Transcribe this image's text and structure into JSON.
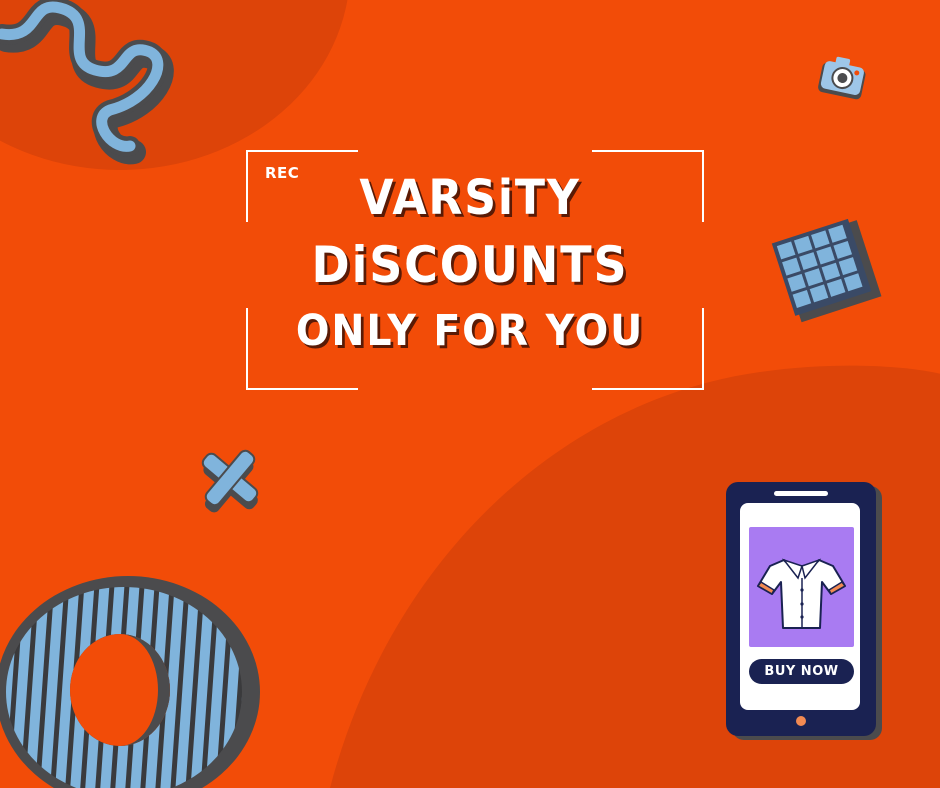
{
  "banner": {
    "rec_label": "REC",
    "headline_line1": "VARSiTY",
    "headline_line2": "DiSCOUNTS",
    "headline_line3": "ONLY FOR YOU"
  },
  "phone": {
    "button_label": "BUY NOW",
    "product_icon": "shirt-icon"
  },
  "decor": {
    "icons": [
      "squiggle-icon",
      "camera-icon",
      "grid-tile-icon",
      "cross-icon",
      "striped-ring-icon"
    ]
  },
  "colors": {
    "background": "#f24c08",
    "blob": "#dd4409",
    "accent_blue": "#80b4dc",
    "shadow": "#4b4b4d",
    "phone_body": "#1a2252",
    "phone_screen": "#ffffff",
    "product_bg": "#a97bf2"
  }
}
